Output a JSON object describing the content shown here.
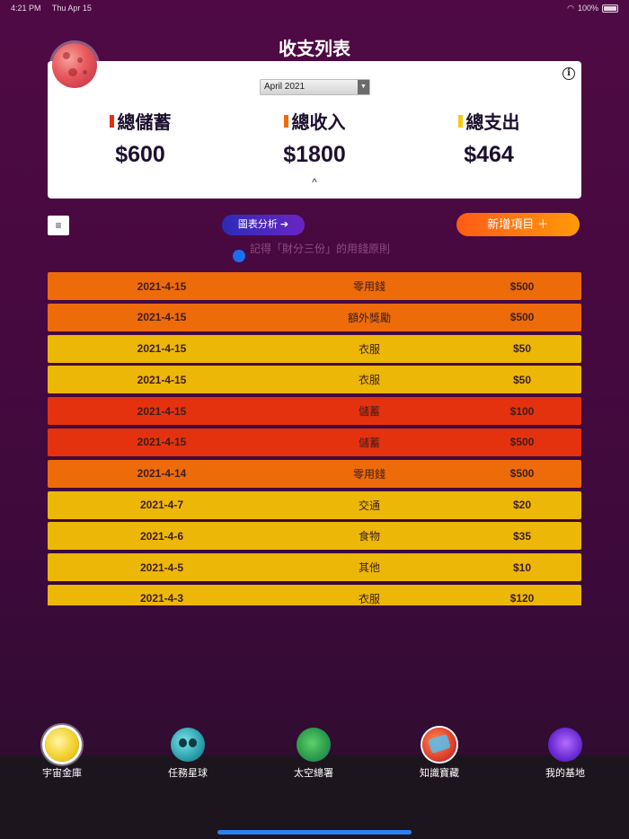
{
  "status_bar": {
    "time": "4:21 PM",
    "date": "Thu Apr 15",
    "battery": "100%"
  },
  "page": {
    "title": "收支列表"
  },
  "summary": {
    "month": "April 2021",
    "savings_label": "總儲蓄",
    "savings_amount": "$600",
    "income_label": "總收入",
    "income_amount": "$1800",
    "expense_label": "總支出",
    "expense_amount": "$464",
    "collapse": "^",
    "colors": {
      "savings": "#e4320f",
      "income": "#ee6b0a",
      "expense": "#ecb707"
    }
  },
  "toolbar": {
    "menu_icon": "≡",
    "chart_button": "圖表分析 ➔",
    "add_button": "新增項目 ＋",
    "hint": "記得「財分三份」的用錢原則"
  },
  "transactions": [
    {
      "date": "2021-4-15",
      "category": "零用錢",
      "amount": "$500",
      "color": "orange"
    },
    {
      "date": "2021-4-15",
      "category": "額外獎勵",
      "amount": "$500",
      "color": "orange"
    },
    {
      "date": "2021-4-15",
      "category": "衣服",
      "amount": "$50",
      "color": "yellow"
    },
    {
      "date": "2021-4-15",
      "category": "衣服",
      "amount": "$50",
      "color": "yellow"
    },
    {
      "date": "2021-4-15",
      "category": "儲蓄",
      "amount": "$100",
      "color": "red"
    },
    {
      "date": "2021-4-15",
      "category": "儲蓄",
      "amount": "$500",
      "color": "red"
    },
    {
      "date": "2021-4-14",
      "category": "零用錢",
      "amount": "$500",
      "color": "orange"
    },
    {
      "date": "2021-4-7",
      "category": "交通",
      "amount": "$20",
      "color": "yellow"
    },
    {
      "date": "2021-4-6",
      "category": "食物",
      "amount": "$35",
      "color": "yellow"
    },
    {
      "date": "2021-4-5",
      "category": "其他",
      "amount": "$10",
      "color": "yellow"
    },
    {
      "date": "2021-4-3",
      "category": "衣服",
      "amount": "$120",
      "color": "yellow"
    }
  ],
  "tabs": [
    {
      "label": "宇宙金庫",
      "icon": "sun-coin-icon"
    },
    {
      "label": "任務星球",
      "icon": "skull-planet-icon"
    },
    {
      "label": "太空總署",
      "icon": "earth-icon"
    },
    {
      "label": "知識寶藏",
      "icon": "knowledge-planet-icon"
    },
    {
      "label": "我的基地",
      "icon": "crystal-base-icon"
    }
  ]
}
